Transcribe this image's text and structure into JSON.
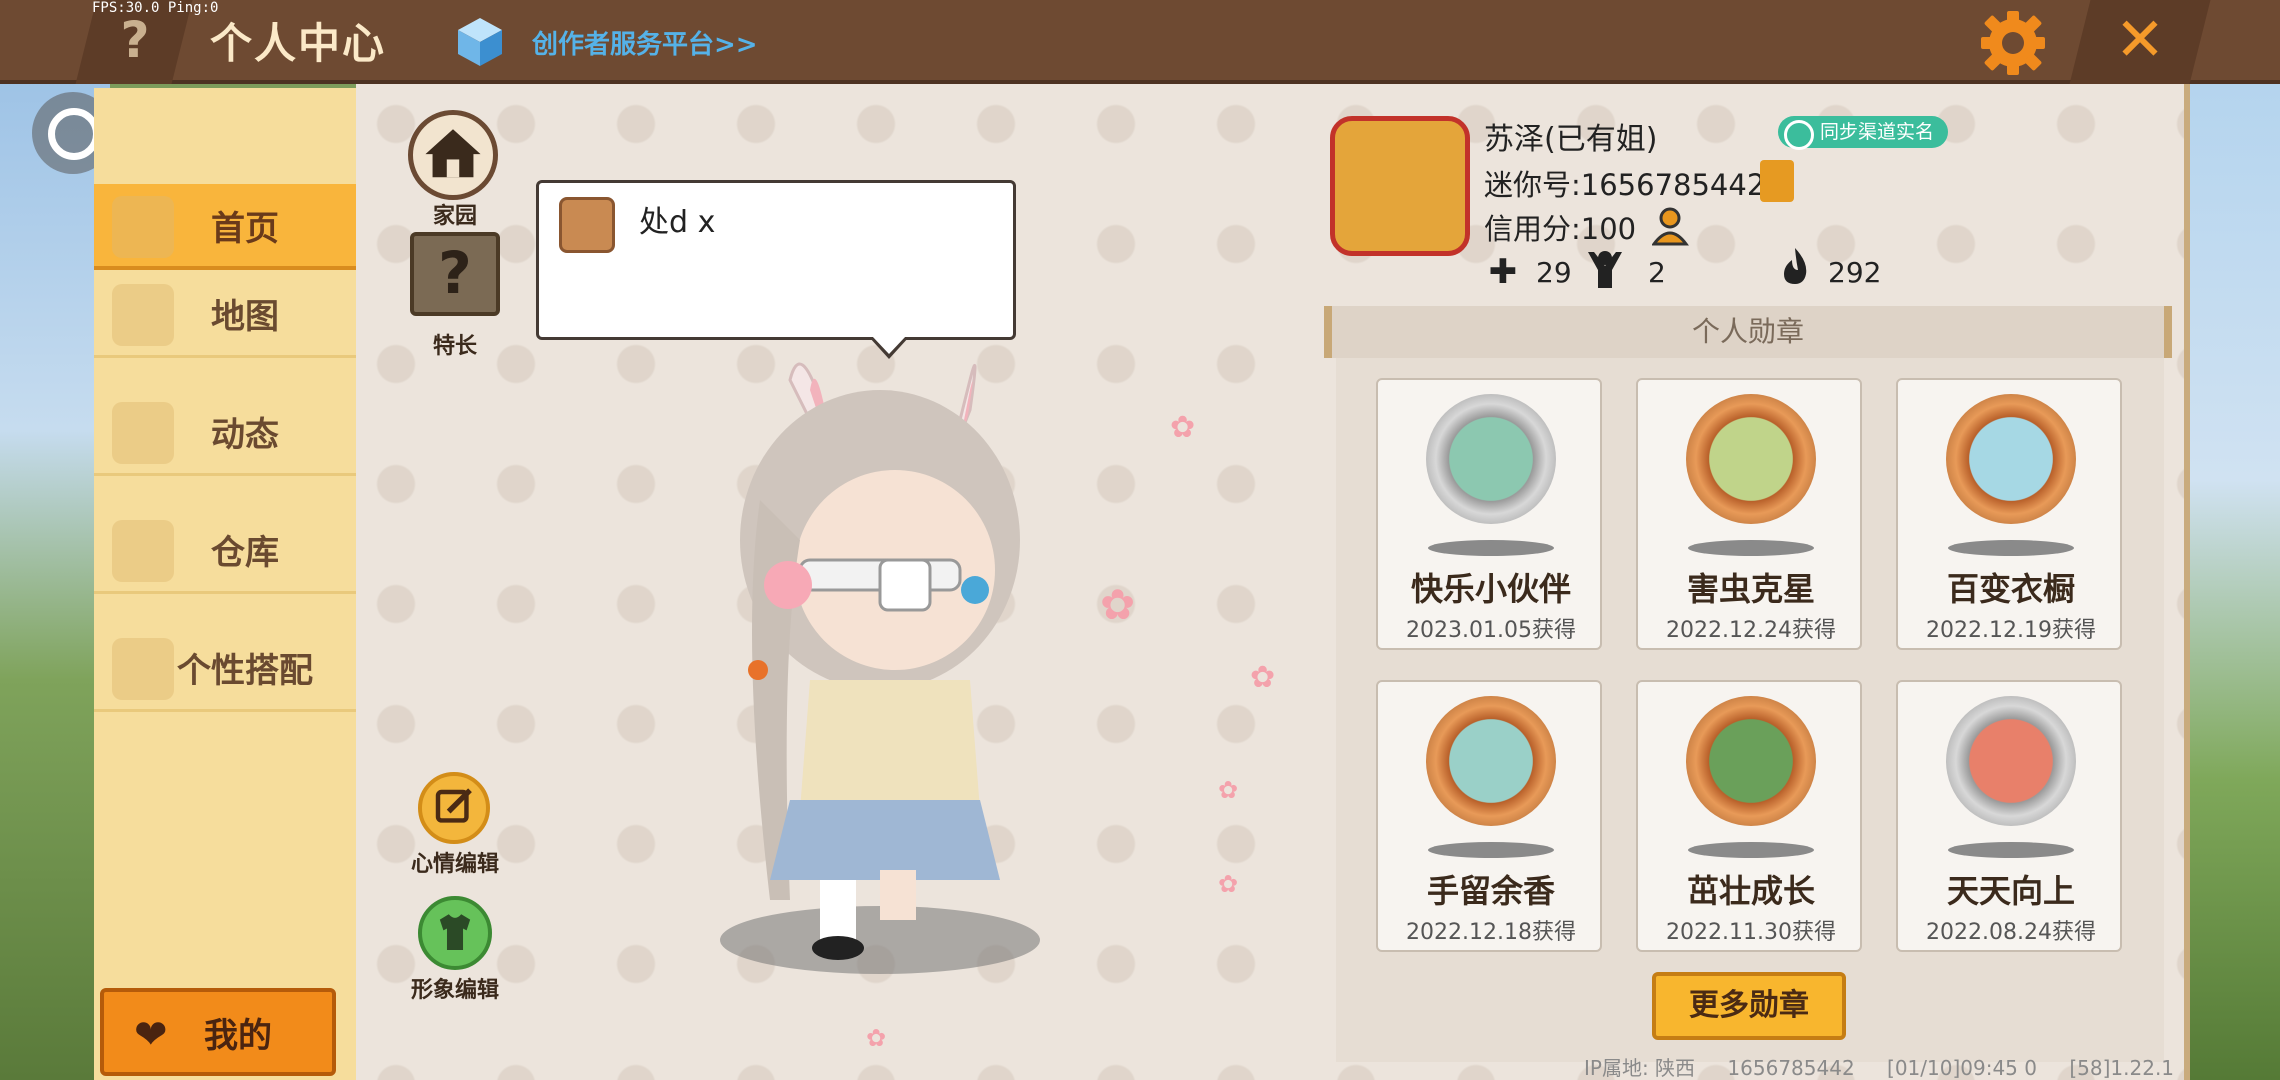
{
  "debug": {
    "fps": "FPS:30.0",
    "ping": "Ping:0"
  },
  "topbar": {
    "help_label": "?",
    "title": "个人中心",
    "creator_link": "创作者服务平台>>",
    "settings_icon": "gear-icon",
    "close_icon": "close-icon"
  },
  "sidebar": {
    "items": [
      {
        "label": "首页",
        "active": true
      },
      {
        "label": "地图",
        "active": false
      },
      {
        "label": "动态",
        "active": false
      },
      {
        "label": "仓库",
        "active": false
      },
      {
        "label": "个性搭配",
        "active": false
      }
    ],
    "mine_button": "我的"
  },
  "side_actions": {
    "home": "家园",
    "talent": "特长",
    "mood_edit": "心情编辑",
    "look_edit": "形象编辑"
  },
  "bubble": {
    "text": "处d x"
  },
  "profile": {
    "name": "苏泽(已有姐)",
    "sync_badge": "同步渠道实名",
    "mini_id": "迷你号:1656785442",
    "credit": "信用分:100",
    "stats": {
      "plus": "29",
      "fans": "2",
      "popularity": "292"
    }
  },
  "medals": {
    "header": "个人勋章",
    "items": [
      {
        "name": "快乐小伙伴",
        "date": "2023.01.05获得",
        "tier": "silver"
      },
      {
        "name": "害虫克星",
        "date": "2022.12.24获得",
        "tier": "bronze"
      },
      {
        "name": "百变衣橱",
        "date": "2022.12.19获得",
        "tier": "bronze"
      },
      {
        "name": "手留余香",
        "date": "2022.12.18获得",
        "tier": "bronze"
      },
      {
        "name": "茁壮成长",
        "date": "2022.11.30获得",
        "tier": "bronze"
      },
      {
        "name": "天天向上",
        "date": "2022.08.24获得",
        "tier": "silver"
      }
    ],
    "more_button": "更多勋章"
  },
  "footer": {
    "ip": "IP属地: 陕西",
    "uid": "1656785442",
    "time": "[01/10]09:45 0",
    "version": "[58]1.22.1"
  },
  "colors": {
    "accent": "#f9b53c",
    "topbar": "#6e4a32",
    "sync": "#3bbd9c"
  }
}
